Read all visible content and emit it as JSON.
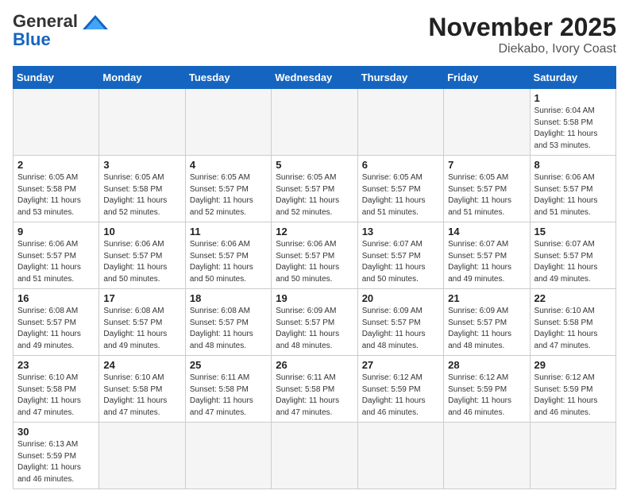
{
  "header": {
    "logo_general": "General",
    "logo_blue": "Blue",
    "title": "November 2025",
    "subtitle": "Diekabo, Ivory Coast"
  },
  "weekdays": [
    "Sunday",
    "Monday",
    "Tuesday",
    "Wednesday",
    "Thursday",
    "Friday",
    "Saturday"
  ],
  "weeks": [
    [
      {
        "day": null,
        "info": null
      },
      {
        "day": null,
        "info": null
      },
      {
        "day": null,
        "info": null
      },
      {
        "day": null,
        "info": null
      },
      {
        "day": null,
        "info": null
      },
      {
        "day": null,
        "info": null
      },
      {
        "day": "1",
        "info": "Sunrise: 6:04 AM\nSunset: 5:58 PM\nDaylight: 11 hours\nand 53 minutes."
      }
    ],
    [
      {
        "day": "2",
        "info": "Sunrise: 6:05 AM\nSunset: 5:58 PM\nDaylight: 11 hours\nand 53 minutes."
      },
      {
        "day": "3",
        "info": "Sunrise: 6:05 AM\nSunset: 5:58 PM\nDaylight: 11 hours\nand 52 minutes."
      },
      {
        "day": "4",
        "info": "Sunrise: 6:05 AM\nSunset: 5:57 PM\nDaylight: 11 hours\nand 52 minutes."
      },
      {
        "day": "5",
        "info": "Sunrise: 6:05 AM\nSunset: 5:57 PM\nDaylight: 11 hours\nand 52 minutes."
      },
      {
        "day": "6",
        "info": "Sunrise: 6:05 AM\nSunset: 5:57 PM\nDaylight: 11 hours\nand 51 minutes."
      },
      {
        "day": "7",
        "info": "Sunrise: 6:05 AM\nSunset: 5:57 PM\nDaylight: 11 hours\nand 51 minutes."
      },
      {
        "day": "8",
        "info": "Sunrise: 6:06 AM\nSunset: 5:57 PM\nDaylight: 11 hours\nand 51 minutes."
      }
    ],
    [
      {
        "day": "9",
        "info": "Sunrise: 6:06 AM\nSunset: 5:57 PM\nDaylight: 11 hours\nand 51 minutes."
      },
      {
        "day": "10",
        "info": "Sunrise: 6:06 AM\nSunset: 5:57 PM\nDaylight: 11 hours\nand 50 minutes."
      },
      {
        "day": "11",
        "info": "Sunrise: 6:06 AM\nSunset: 5:57 PM\nDaylight: 11 hours\nand 50 minutes."
      },
      {
        "day": "12",
        "info": "Sunrise: 6:06 AM\nSunset: 5:57 PM\nDaylight: 11 hours\nand 50 minutes."
      },
      {
        "day": "13",
        "info": "Sunrise: 6:07 AM\nSunset: 5:57 PM\nDaylight: 11 hours\nand 50 minutes."
      },
      {
        "day": "14",
        "info": "Sunrise: 6:07 AM\nSunset: 5:57 PM\nDaylight: 11 hours\nand 49 minutes."
      },
      {
        "day": "15",
        "info": "Sunrise: 6:07 AM\nSunset: 5:57 PM\nDaylight: 11 hours\nand 49 minutes."
      }
    ],
    [
      {
        "day": "16",
        "info": "Sunrise: 6:08 AM\nSunset: 5:57 PM\nDaylight: 11 hours\nand 49 minutes."
      },
      {
        "day": "17",
        "info": "Sunrise: 6:08 AM\nSunset: 5:57 PM\nDaylight: 11 hours\nand 49 minutes."
      },
      {
        "day": "18",
        "info": "Sunrise: 6:08 AM\nSunset: 5:57 PM\nDaylight: 11 hours\nand 48 minutes."
      },
      {
        "day": "19",
        "info": "Sunrise: 6:09 AM\nSunset: 5:57 PM\nDaylight: 11 hours\nand 48 minutes."
      },
      {
        "day": "20",
        "info": "Sunrise: 6:09 AM\nSunset: 5:57 PM\nDaylight: 11 hours\nand 48 minutes."
      },
      {
        "day": "21",
        "info": "Sunrise: 6:09 AM\nSunset: 5:57 PM\nDaylight: 11 hours\nand 48 minutes."
      },
      {
        "day": "22",
        "info": "Sunrise: 6:10 AM\nSunset: 5:58 PM\nDaylight: 11 hours\nand 47 minutes."
      }
    ],
    [
      {
        "day": "23",
        "info": "Sunrise: 6:10 AM\nSunset: 5:58 PM\nDaylight: 11 hours\nand 47 minutes."
      },
      {
        "day": "24",
        "info": "Sunrise: 6:10 AM\nSunset: 5:58 PM\nDaylight: 11 hours\nand 47 minutes."
      },
      {
        "day": "25",
        "info": "Sunrise: 6:11 AM\nSunset: 5:58 PM\nDaylight: 11 hours\nand 47 minutes."
      },
      {
        "day": "26",
        "info": "Sunrise: 6:11 AM\nSunset: 5:58 PM\nDaylight: 11 hours\nand 47 minutes."
      },
      {
        "day": "27",
        "info": "Sunrise: 6:12 AM\nSunset: 5:59 PM\nDaylight: 11 hours\nand 46 minutes."
      },
      {
        "day": "28",
        "info": "Sunrise: 6:12 AM\nSunset: 5:59 PM\nDaylight: 11 hours\nand 46 minutes."
      },
      {
        "day": "29",
        "info": "Sunrise: 6:12 AM\nSunset: 5:59 PM\nDaylight: 11 hours\nand 46 minutes."
      }
    ],
    [
      {
        "day": "30",
        "info": "Sunrise: 6:13 AM\nSunset: 5:59 PM\nDaylight: 11 hours\nand 46 minutes."
      },
      {
        "day": null,
        "info": null
      },
      {
        "day": null,
        "info": null
      },
      {
        "day": null,
        "info": null
      },
      {
        "day": null,
        "info": null
      },
      {
        "day": null,
        "info": null
      },
      {
        "day": null,
        "info": null
      }
    ]
  ]
}
